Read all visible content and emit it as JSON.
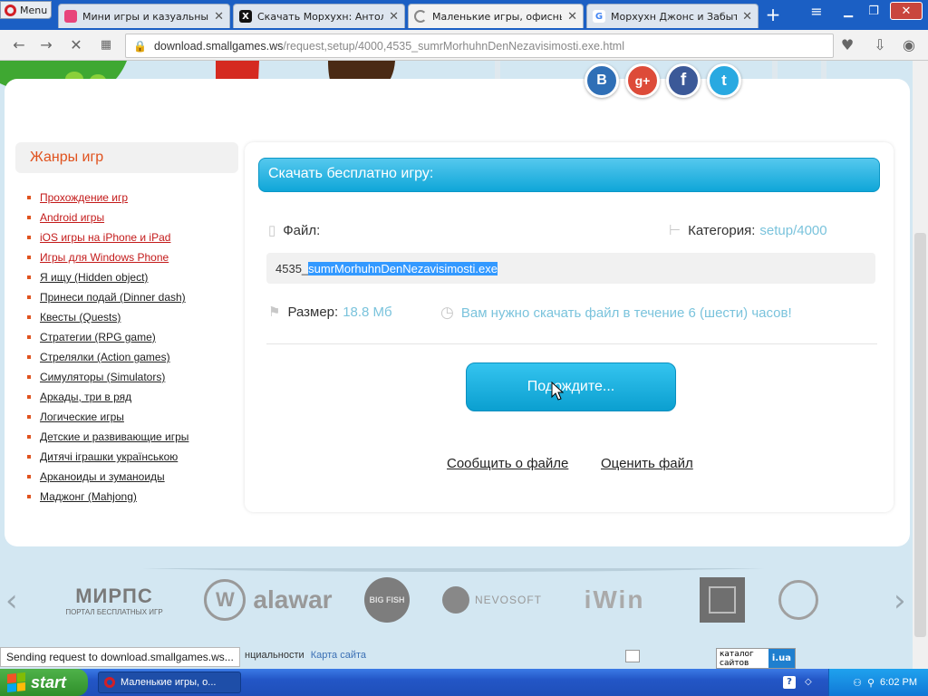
{
  "browser": {
    "menu_label": "Menu",
    "tabs": [
      {
        "title": "Мини игры и казуальные и",
        "favicon_color": "#e8447b"
      },
      {
        "title": "Скачать Морхухн: Антоло",
        "favicon_color": "#111111",
        "favicon_letter": "X"
      },
      {
        "title": "Маленькие игры, офисные",
        "favicon_color": "#888888",
        "active": true
      },
      {
        "title": "Морхухн Джонс и Забытый",
        "favicon_color": "#4285f4",
        "favicon_letter": "G"
      }
    ],
    "url_host": "download.smallgames.ws",
    "url_path": "/request,setup/4000,4535_sumrMorhuhnDenNezavisimosti.exe.html",
    "url_prefix": "download."
  },
  "sidebar": {
    "title": "Жанры игр",
    "items": [
      {
        "label": "Прохождение игр",
        "visited": true
      },
      {
        "label": "Android игры",
        "visited": true
      },
      {
        "label": "iOS игры на iPhone и iPad",
        "visited": true
      },
      {
        "label": "Игры для Windows Phone",
        "visited": true
      },
      {
        "label": "Я ищу (Hidden object)"
      },
      {
        "label": "Принеси подай (Dinner dash)"
      },
      {
        "label": "Квесты (Quests)"
      },
      {
        "label": "Стратегии (RPG game)"
      },
      {
        "label": "Стрелялки (Action games)"
      },
      {
        "label": "Симуляторы (Simulators)"
      },
      {
        "label": "Аркады, три в ряд"
      },
      {
        "label": "Логические игры"
      },
      {
        "label": "Детские и развивающие игры"
      },
      {
        "label": "Дитячі іграшки українською"
      },
      {
        "label": "Арканоиды и зуманоиды"
      },
      {
        "label": "Маджонг (Mahjong)"
      }
    ]
  },
  "download": {
    "heading": "Скачать бесплатно игру:",
    "file_label": "Файл:",
    "category_label": "Категория:",
    "category_value": "setup/4000",
    "file_prefix": "4535_",
    "file_selected": "sumrMorhuhnDenNezavisimosti.exe",
    "size_label": "Размер:",
    "size_value": "18.8 Мб",
    "notice": "Вам нужно скачать файл в течение 6 (шести) часов!",
    "wait_button": "Подождите...",
    "report_link": "Сообщить о файле",
    "rate_link": "Оценить файл"
  },
  "social": [
    {
      "label": "B",
      "color": "#2f6fb6"
    },
    {
      "label": "g+",
      "color": "#dd4b39"
    },
    {
      "label": "f",
      "color": "#3b5998"
    },
    {
      "label": "t",
      "color": "#29a9e1"
    }
  ],
  "partners": {
    "mirpc_title": "МИРПС",
    "mirpc_sub": "ПОРТАЛ БЕСПЛАТНЫХ ИГР",
    "alawar": "alawar",
    "bigfish": "BIG FISH",
    "nevosoft": "NEVOSOFT",
    "iwin": "iWin"
  },
  "footer": {
    "privacy": "нциальности",
    "sitemap": "Карта сайта",
    "catalog": "каталог сайтов",
    "catalog_badge": "i.ua"
  },
  "status_text": "Sending request to download.smallgames.ws...",
  "taskbar": {
    "start": "start",
    "window": "Маленькие игры, о...",
    "time": "6:02 PM",
    "help": "?"
  }
}
